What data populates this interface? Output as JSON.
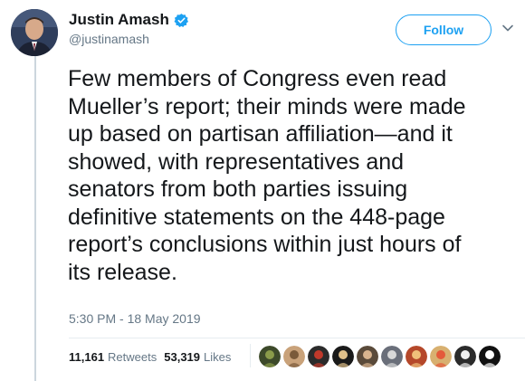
{
  "author": {
    "display_name": "Justin Amash",
    "handle": "@justinamash",
    "verified_icon": "verified-badge-icon"
  },
  "follow_label": "Follow",
  "tweet_text": "Few members of Congress even read\nMueller’s report; their minds were made\nup based on partisan affiliation—and it\nshowed, with representatives and\nsenators from both parties issuing\ndefinitive statements on the 448-page\nreport’s conclusions within just hours of\nits release.",
  "timestamp": "5:30 PM - 18 May 2019",
  "retweets": {
    "count": "11,161",
    "label": "Retweets"
  },
  "likes": {
    "count": "53,319",
    "label": "Likes"
  },
  "likers": [
    {
      "color": "#3d4a2a",
      "accent": "#8a9b4a"
    },
    {
      "color": "#c9a27a",
      "accent": "#7a5a3a"
    },
    {
      "color": "#2b2b2b",
      "accent": "#c0392b"
    },
    {
      "color": "#1a1a1a",
      "accent": "#e0c08a"
    },
    {
      "color": "#5a4a3a",
      "accent": "#d9b48f"
    },
    {
      "color": "#6a6f7a",
      "accent": "#d8d8d8"
    },
    {
      "color": "#b5482a",
      "accent": "#f0c07a"
    },
    {
      "color": "#d8b070",
      "accent": "#e45a3a"
    },
    {
      "color": "#2b2b2b",
      "accent": "#f0f0f0"
    },
    {
      "color": "#111111",
      "accent": "#ffffff"
    }
  ],
  "colors": {
    "accent": "#1da1f2",
    "secondary_text": "#657786"
  }
}
